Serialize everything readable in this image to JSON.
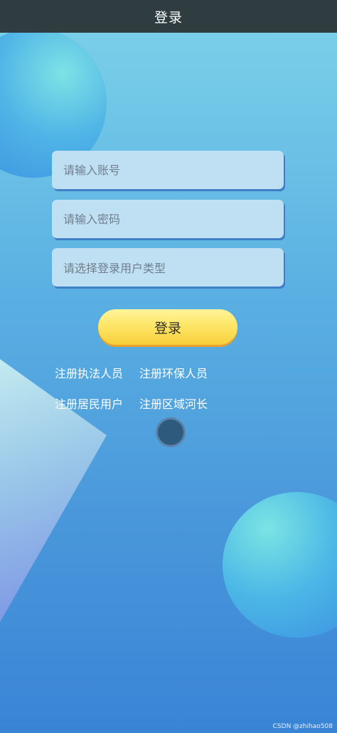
{
  "app": {
    "title": "登录"
  },
  "form": {
    "account_placeholder": "请输入账号",
    "password_placeholder": "请输入密码",
    "user_type_placeholder": "请选择登录用户类型",
    "login_label": "登录"
  },
  "links": {
    "register_law_enforcement": "注册执法人员",
    "register_env_protection": "注册环保人员",
    "register_resident": "注册居民用户",
    "register_river_chief": "注册区域河长"
  },
  "footer": {
    "watermark": "CSDN @zhihao508"
  },
  "colors": {
    "title_bar": "#2f3c40",
    "input_bg": "#bfdff3",
    "button_yellow": "#fde668",
    "background_top": "#7dd3e9",
    "background_bottom": "#3a84d6"
  },
  "icons": {
    "decorative_circle": "circle-shape",
    "decorative_triangle": "triangle-shape",
    "loading_dot": "dot-indicator"
  }
}
